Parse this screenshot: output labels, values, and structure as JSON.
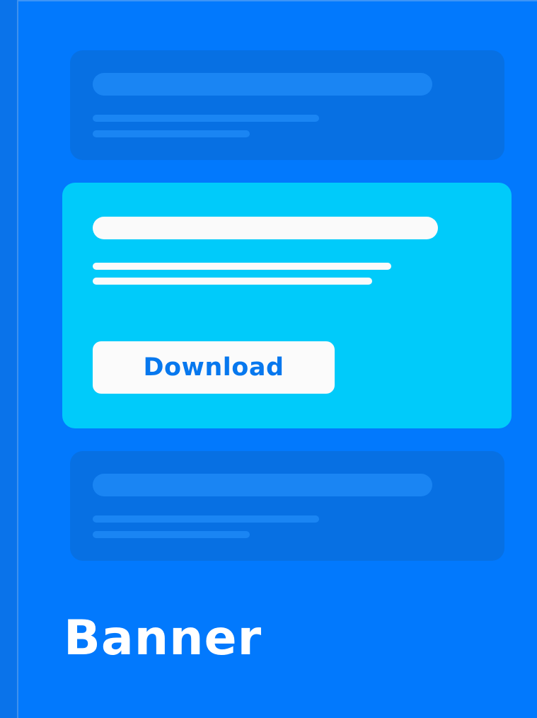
{
  "colors": {
    "background": "#0279fd",
    "dim_card": "#0770e3",
    "feature_card": "#00cbfa",
    "button_text": "#0778ee"
  },
  "feature_card": {
    "button_label": "Download"
  },
  "banner": {
    "title": "Banner"
  }
}
